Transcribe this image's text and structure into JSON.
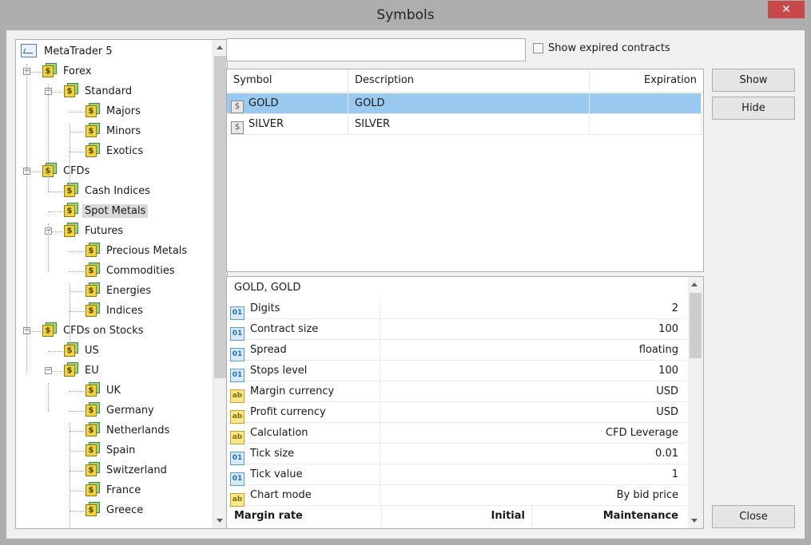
{
  "window": {
    "title": "Symbols",
    "close_glyph": "✕"
  },
  "tree": {
    "root": "MetaTrader 5",
    "nodes": [
      {
        "label": "Forex",
        "level": 1,
        "expander": "−"
      },
      {
        "label": "Standard",
        "level": 2,
        "expander": "−"
      },
      {
        "label": "Majors",
        "level": 3
      },
      {
        "label": "Minors",
        "level": 3
      },
      {
        "label": "Exotics",
        "level": 3
      },
      {
        "label": "CFDs",
        "level": 1,
        "expander": "−"
      },
      {
        "label": "Cash Indices",
        "level": 2
      },
      {
        "label": "Spot Metals",
        "level": 2,
        "selected": true
      },
      {
        "label": "Futures",
        "level": 2,
        "expander": "−"
      },
      {
        "label": "Precious Metals",
        "level": 3
      },
      {
        "label": "Commodities",
        "level": 3
      },
      {
        "label": "Energies",
        "level": 3
      },
      {
        "label": "Indices",
        "level": 3
      },
      {
        "label": "CFDs on Stocks",
        "level": 1,
        "expander": "−"
      },
      {
        "label": "US",
        "level": 2
      },
      {
        "label": "EU",
        "level": 2,
        "expander": "−"
      },
      {
        "label": "UK",
        "level": 3
      },
      {
        "label": "Germany",
        "level": 3
      },
      {
        "label": "Netherlands",
        "level": 3
      },
      {
        "label": "Spain",
        "level": 3
      },
      {
        "label": "Switzerland",
        "level": 3
      },
      {
        "label": "France",
        "level": 3
      },
      {
        "label": "Greece",
        "level": 3
      }
    ]
  },
  "search": {
    "value": ""
  },
  "show_expired": {
    "label": "Show expired contracts",
    "checked": false
  },
  "symbols": {
    "columns": [
      "Symbol",
      "Description",
      "Expiration"
    ],
    "rows": [
      {
        "symbol": "GOLD",
        "description": "GOLD",
        "expiration": "",
        "selected": true
      },
      {
        "symbol": "SILVER",
        "description": "SILVER",
        "expiration": "",
        "selected": false
      }
    ]
  },
  "buttons": {
    "show": "Show",
    "hide": "Hide",
    "close": "Close"
  },
  "properties": {
    "title": "GOLD, GOLD",
    "rows": [
      {
        "name": "Digits",
        "value": "2",
        "kind": "num"
      },
      {
        "name": "Contract size",
        "value": "100",
        "kind": "num"
      },
      {
        "name": "Spread",
        "value": "floating",
        "kind": "num"
      },
      {
        "name": "Stops level",
        "value": "100",
        "kind": "num"
      },
      {
        "name": "Margin currency",
        "value": "USD",
        "kind": "txt"
      },
      {
        "name": "Profit currency",
        "value": "USD",
        "kind": "txt"
      },
      {
        "name": "Calculation",
        "value": "CFD Leverage",
        "kind": "txt"
      },
      {
        "name": "Tick size",
        "value": "0.01",
        "kind": "num"
      },
      {
        "name": "Tick value",
        "value": "1",
        "kind": "num"
      },
      {
        "name": "Chart mode",
        "value": "By bid price",
        "kind": "txt"
      }
    ],
    "margin_header": {
      "name": "Margin rate",
      "initial": "Initial",
      "maintenance": "Maintenance"
    },
    "icon_text": {
      "num": "01",
      "txt": "ab"
    }
  },
  "icons": {
    "folder": "$",
    "symbol": "$"
  }
}
